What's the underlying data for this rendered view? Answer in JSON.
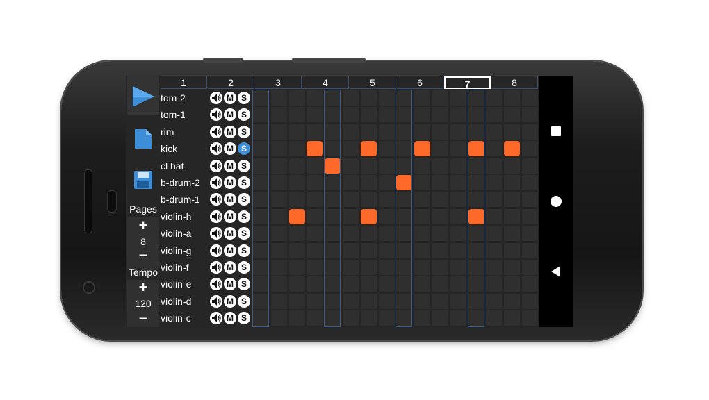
{
  "toolbar": {
    "pages_label": "Pages",
    "pages_value": "8",
    "tempo_label": "Tempo",
    "tempo_value": "120",
    "plus": "+",
    "minus": "−"
  },
  "header": {
    "pages": [
      "1",
      "2",
      "3",
      "4",
      "5",
      "6",
      "7",
      "8"
    ],
    "current_page": "7"
  },
  "tracks": [
    {
      "name": "tom-2",
      "solo": false
    },
    {
      "name": "tom-1",
      "solo": false
    },
    {
      "name": "rim",
      "solo": false
    },
    {
      "name": "kick",
      "solo": true
    },
    {
      "name": "cl hat",
      "solo": false
    },
    {
      "name": "b-drum-2",
      "solo": false
    },
    {
      "name": "b-drum-1",
      "solo": false
    },
    {
      "name": "violin-h",
      "solo": false
    },
    {
      "name": "violin-a",
      "solo": false
    },
    {
      "name": "violin-g",
      "solo": false
    },
    {
      "name": "violin-f",
      "solo": false
    },
    {
      "name": "violin-e",
      "solo": false
    },
    {
      "name": "violin-d",
      "solo": false
    },
    {
      "name": "violin-c",
      "solo": false
    }
  ],
  "controls": {
    "mute": "M",
    "solo": "S",
    "volume_icon": "speaker-icon"
  },
  "grid": {
    "steps": 16,
    "active": [
      {
        "track": 3,
        "step": 3
      },
      {
        "track": 3,
        "step": 6
      },
      {
        "track": 3,
        "step": 9
      },
      {
        "track": 3,
        "step": 12
      },
      {
        "track": 3,
        "step": 14
      },
      {
        "track": 4,
        "step": 4
      },
      {
        "track": 5,
        "step": 8
      },
      {
        "track": 7,
        "step": 2
      },
      {
        "track": 7,
        "step": 6
      },
      {
        "track": 7,
        "step": 12
      }
    ],
    "beat_columns": [
      0,
      4,
      8,
      12
    ]
  },
  "colors": {
    "note": "#ff6a2a",
    "accent": "#3d8ed6",
    "background": "#262626"
  }
}
